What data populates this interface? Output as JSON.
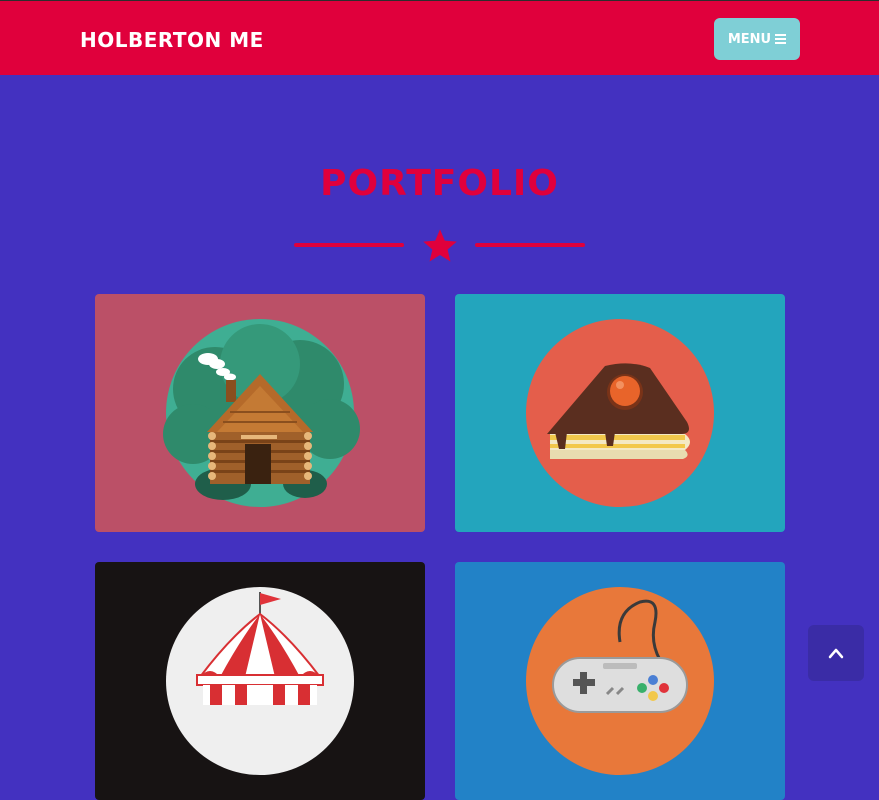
{
  "navbar": {
    "brand": "HOLBERTON ME",
    "menu_label": "MENU",
    "menu_icon": "bars-icon"
  },
  "section": {
    "title": "PORTFOLIO",
    "divider_icon": "star-icon"
  },
  "portfolio": {
    "items": [
      {
        "image": "cabin-illustration",
        "background": "#bb5067"
      },
      {
        "image": "cake-illustration",
        "background": "#23a5bd"
      },
      {
        "image": "circus-illustration",
        "background": "#171313"
      },
      {
        "image": "game-controller-illustration",
        "background": "#2282c7"
      }
    ]
  },
  "scroll_top": {
    "icon": "chevron-up-icon"
  },
  "colors": {
    "brand": "#e0003c",
    "background": "#4331c0",
    "menu_button": "#7fcfd6"
  }
}
